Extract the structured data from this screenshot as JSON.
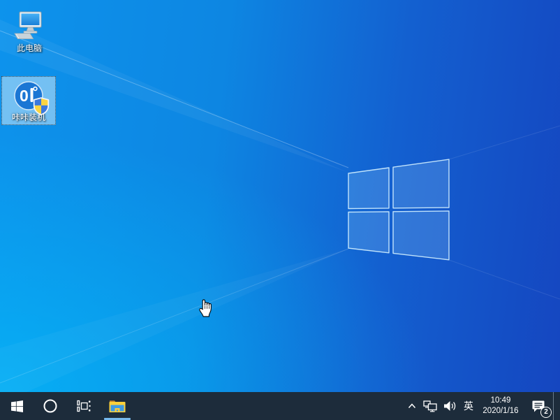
{
  "desktop": {
    "icons": [
      {
        "label": "此电脑",
        "selected": false
      },
      {
        "label": "咔咔装机",
        "selected": true
      }
    ],
    "cursor": "hand-pointer"
  },
  "wallpaper": {
    "description": "windows-10-default-light-rays-logo",
    "colors": {
      "left_azure": "#0d93ec",
      "bottom_left_cyan": "#00c8ff",
      "right_deep_blue": "#1546c0",
      "logo_edge": "#bfe9ff"
    }
  },
  "taskbar": {
    "bg_color": "#1d2c3b",
    "accent_underline": "#76b9ed",
    "buttons": [
      "start",
      "cortana-search",
      "task-view",
      "file-explorer"
    ],
    "active_button": "file-explorer",
    "tray": {
      "icons": [
        "hidden-icons-chevron",
        "network",
        "volume",
        "input-method",
        "clock",
        "action-center"
      ],
      "input_indicator": "英",
      "time": "10:49",
      "date": "2020/1/16",
      "notification_count": "2"
    }
  },
  "app_icon_colors": {
    "kaka_circle_blue": "#1b76d4",
    "shield_blue": "#3b78dd",
    "shield_yellow": "#fbd440",
    "folder_yellow": "#fcd139",
    "folder_front_blue": "#3f9be2"
  }
}
